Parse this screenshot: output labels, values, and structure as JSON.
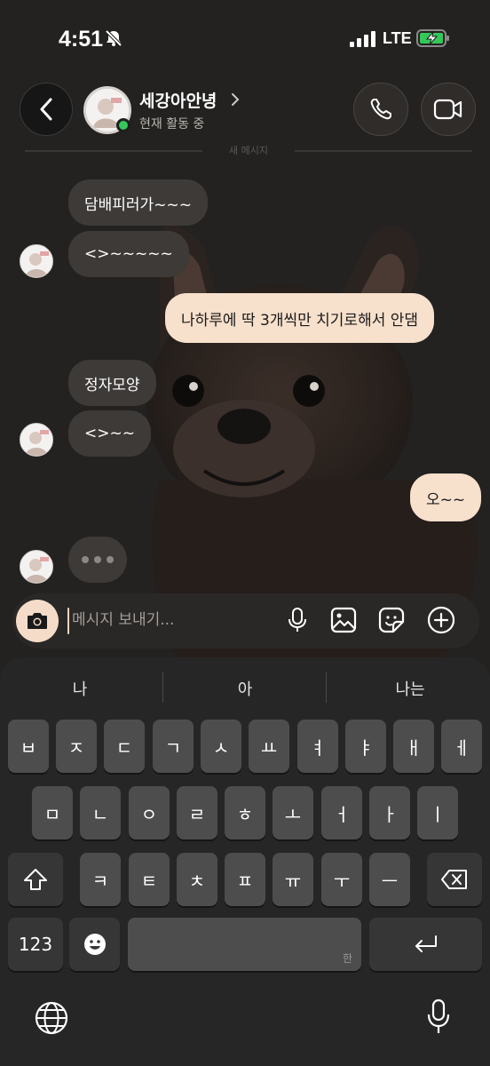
{
  "status_bar": {
    "time": "4:51",
    "network": "LTE"
  },
  "header": {
    "name": "세강아안녕",
    "status": "현재 활동 중",
    "new_message_divider": "새 메시지"
  },
  "messages": [
    {
      "side": "in",
      "text": "담배피러가~~~"
    },
    {
      "side": "in",
      "text": "<>~~~~~"
    },
    {
      "side": "out",
      "text": "나하루에 딱 3개씩만 치기로해서 안댐"
    },
    {
      "side": "in",
      "text": "정자모양"
    },
    {
      "side": "in",
      "text": "<>~~"
    },
    {
      "side": "out",
      "text": "오~~"
    }
  ],
  "composer": {
    "placeholder": "메시지 보내기..."
  },
  "keyboard": {
    "suggestions": [
      "나",
      "아",
      "나는"
    ],
    "row1": [
      "ㅂ",
      "ㅈ",
      "ㄷ",
      "ㄱ",
      "ㅅ",
      "ㅛ",
      "ㅕ",
      "ㅑ",
      "ㅐ",
      "ㅔ"
    ],
    "row2": [
      "ㅁ",
      "ㄴ",
      "ㅇ",
      "ㄹ",
      "ㅎ",
      "ㅗ",
      "ㅓ",
      "ㅏ",
      "ㅣ"
    ],
    "row3": [
      "ㅋ",
      "ㅌ",
      "ㅊ",
      "ㅍ",
      "ㅠ",
      "ㅜ",
      "ㅡ"
    ],
    "numbers_label": "123",
    "space_hint": "한"
  },
  "icons": {
    "back": "chevron-left-icon",
    "call": "phone-icon",
    "video": "video-camera-icon",
    "camera": "camera-icon",
    "mic": "microphone-icon",
    "gallery": "image-icon",
    "sticker": "sticker-icon",
    "add": "plus-circle-icon",
    "shift": "shift-icon",
    "delete": "backspace-icon",
    "emoji": "emoji-icon",
    "return": "return-icon",
    "globe": "globe-icon",
    "dictation": "microphone-icon"
  },
  "colors": {
    "outgoing_bubble": "#f7e0cc",
    "incoming_bubble": "#3d3a38",
    "online": "#35c759",
    "accent": "#f5dcc8"
  }
}
